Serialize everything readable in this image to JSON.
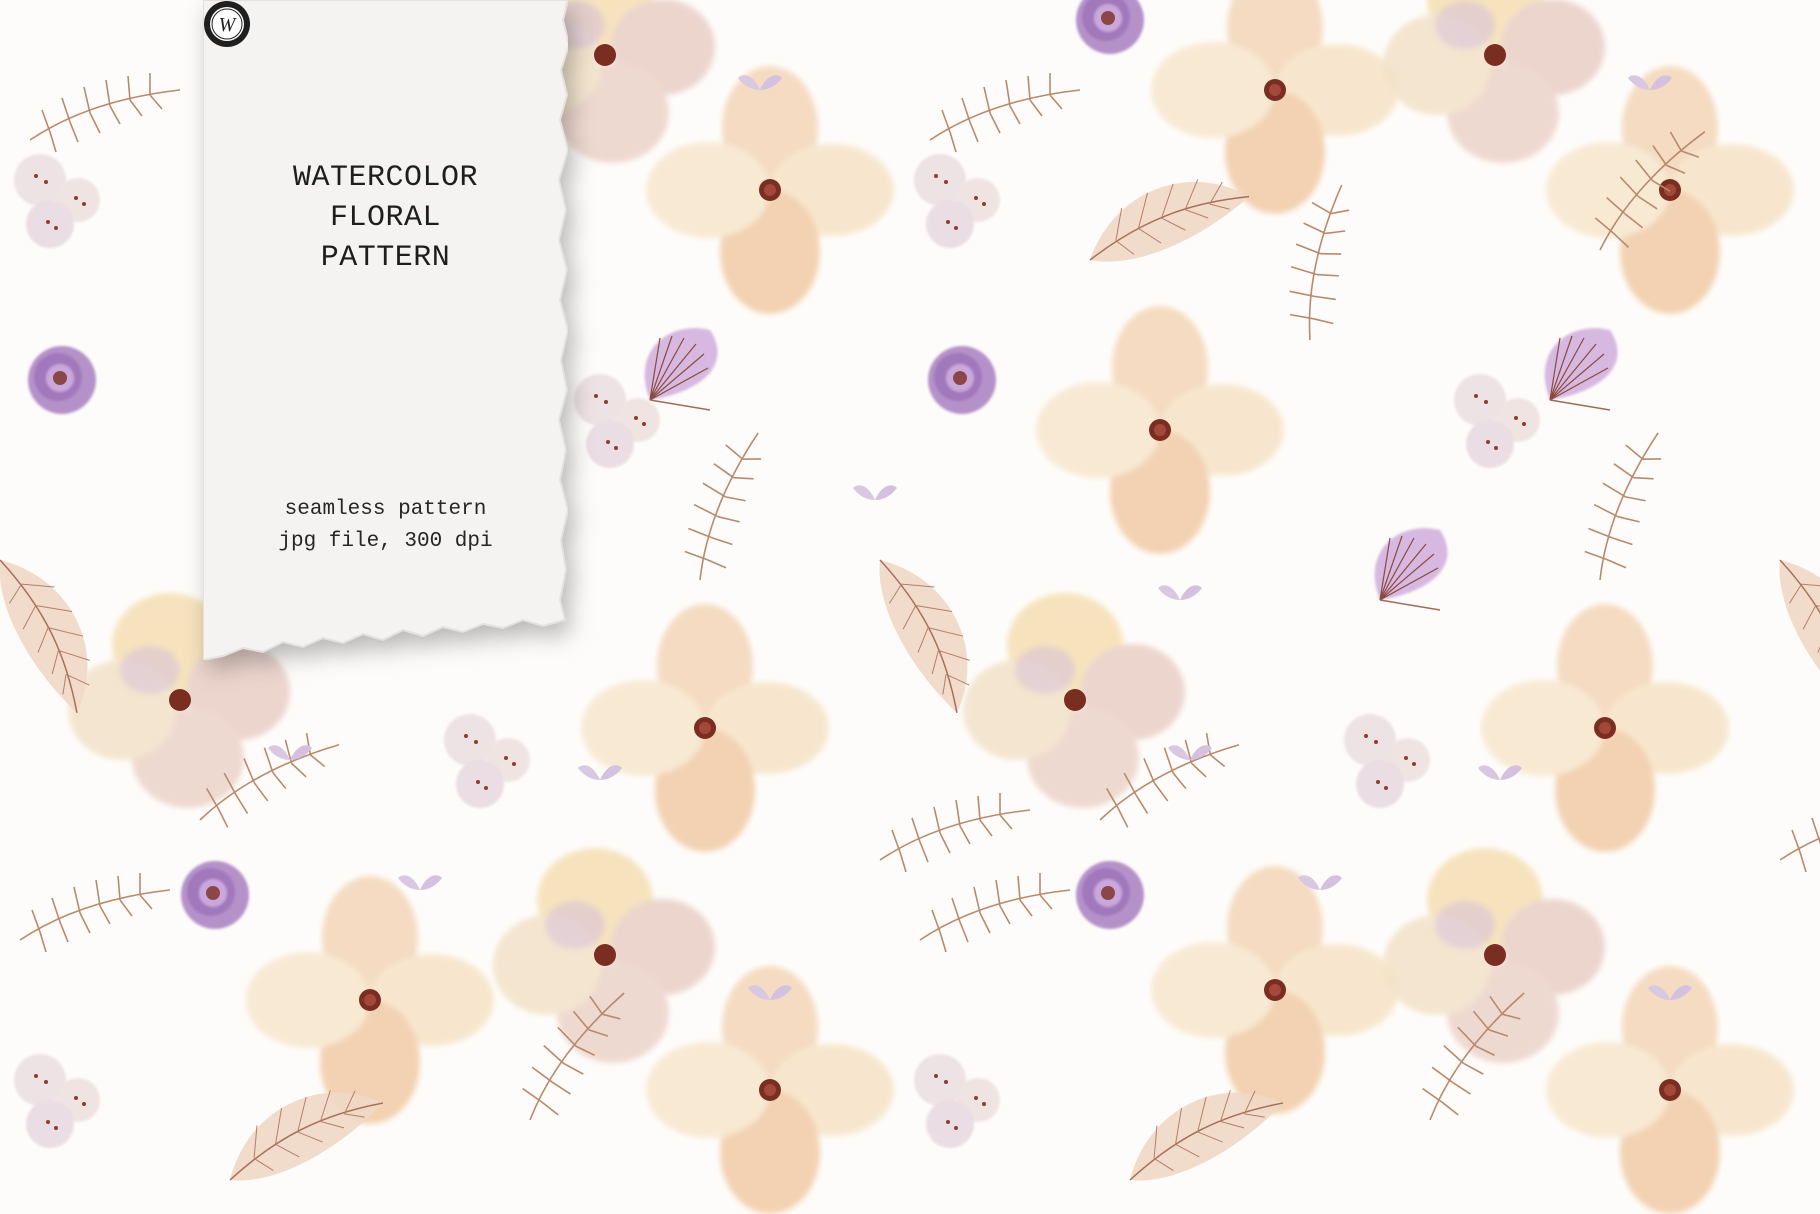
{
  "card": {
    "title_lines": [
      "WATERCOLOR",
      "FLORAL",
      "PATTERN"
    ],
    "details": [
      "seamless pattern",
      "jpg file, 300 dpi"
    ]
  },
  "logo": {
    "icon": "w-monogram-badge-icon",
    "letter": "W"
  },
  "palette": {
    "background": "#fefcfa",
    "peach": "#f2cfae",
    "cream": "#f6e2bd",
    "lavender": "#b591c9",
    "leaf_brown": "#b88a6c",
    "center_dark": "#7a2e22",
    "paper": "#f4f3f1"
  }
}
